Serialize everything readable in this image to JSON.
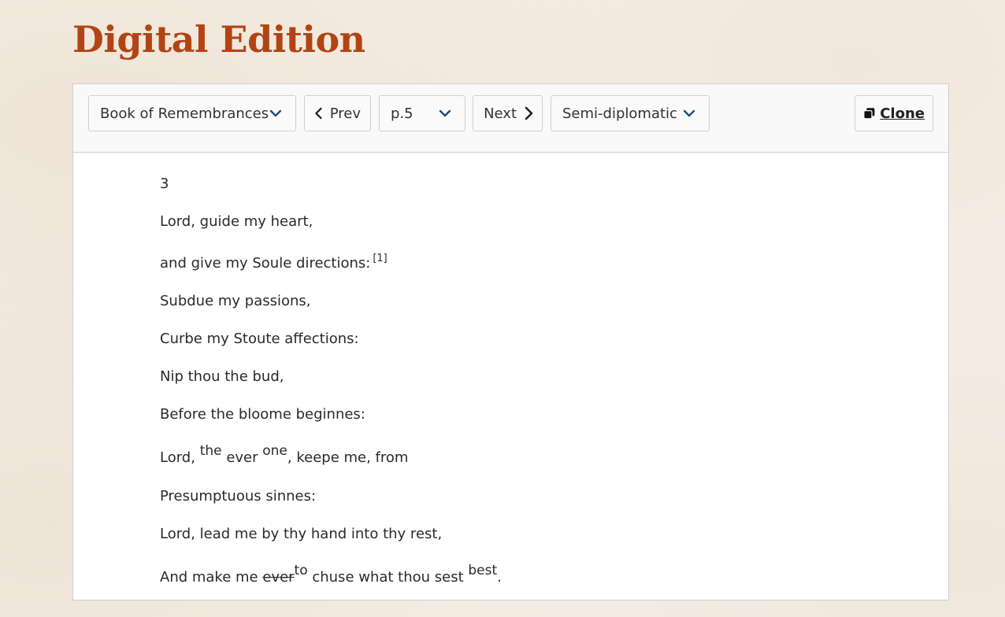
{
  "page": {
    "title": "Digital Edition"
  },
  "toolbar": {
    "document_select": {
      "value": "Book of Remembrances",
      "icon": "chevron-down-icon"
    },
    "prev_button": {
      "label": "Prev",
      "icon": "chevron-left-icon"
    },
    "page_select": {
      "value": "p.5",
      "icon": "chevron-down-icon"
    },
    "next_button": {
      "label": "Next",
      "icon": "chevron-right-icon"
    },
    "view_select": {
      "value": "Semi-diplomatic",
      "icon": "chevron-down-icon"
    },
    "clone_button": {
      "label": "Clone",
      "icon": "clone-icon"
    }
  },
  "text": {
    "page_number": "3",
    "lines": {
      "l1": "Lord, guide my heart,",
      "l2": {
        "text": "and give my Soule directions:",
        "note_ref": "[1]"
      },
      "l3": "Subdue my passions,",
      "l4": "Curbe my Stoute affections:",
      "l5": "Nip thou the bud,",
      "l6": "Before the bloome beginnes:",
      "l7": {
        "a": "Lord, ",
        "sup1": "the",
        "b": " ever ",
        "sup2": "one",
        "c": ", keepe me, from"
      },
      "l8": "Presumptuous sinnes:",
      "l9": "Lord, lead me by thy hand into thy rest,",
      "l10": {
        "a": "And make me ",
        "deleted": "ever",
        "sup1": "to",
        "b": " chuse what thou sest ",
        "sup2": "best",
        "c": "."
      }
    }
  },
  "colors": {
    "title": "#b24414",
    "icon_accent": "#1f4e79",
    "background": "#f6efe6",
    "panel_border": "#cfcfcf"
  }
}
